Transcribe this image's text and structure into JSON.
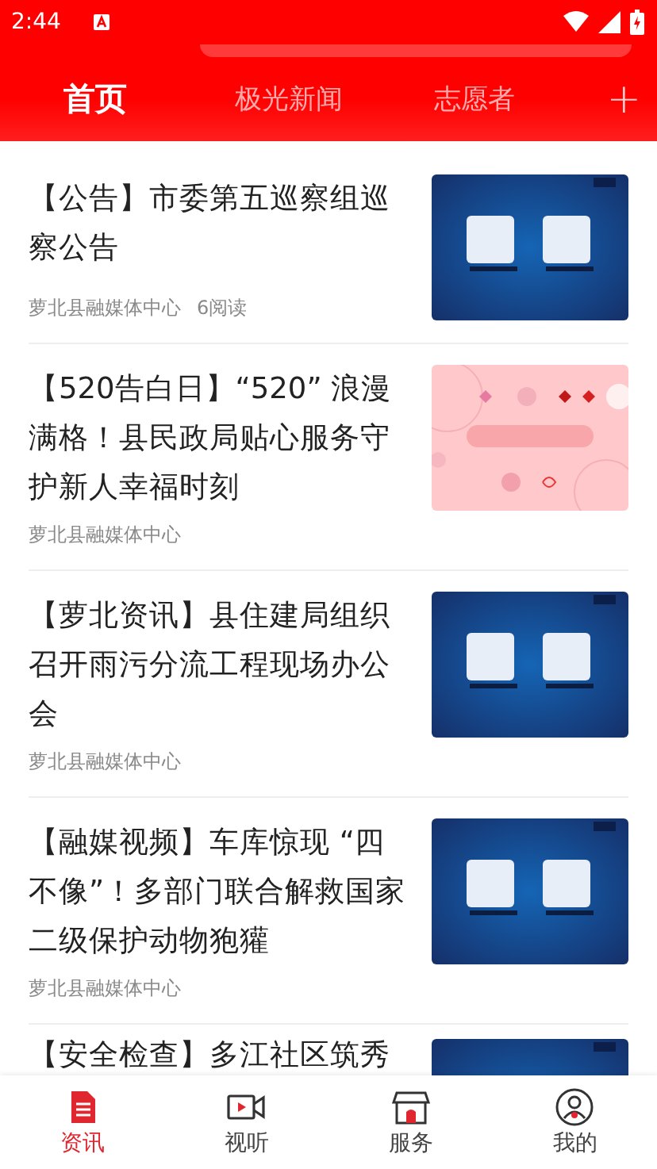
{
  "status_bar": {
    "time": "2:44"
  },
  "tabs": [
    {
      "label": "首页",
      "selected": true
    },
    {
      "label": "极光新闻",
      "selected": false
    },
    {
      "label": "志愿者",
      "selected": false
    }
  ],
  "add_tab": "+",
  "articles": [
    {
      "title": "【公告】市委第五巡察组巡察公告",
      "source": "萝北县融媒体中心",
      "reads": "6阅读"
    },
    {
      "title": "【520告白日】“520” 浪漫满格！县民政局贴心服务守护新人幸福时刻",
      "source": "萝北县融媒体中心"
    },
    {
      "title": "【萝北资讯】县住建局组织召开雨污分流工程现场办公会",
      "source": "萝北县融媒体中心"
    },
    {
      "title": "【融媒视频】车库惊现 “四不像”！多部门联合解救国家二级保护动物狍獾",
      "source": "萝北县融媒体中心"
    },
    {
      "title": "【安全检查】多江社区筑秀"
    }
  ],
  "bottom_nav": [
    {
      "label": "资讯",
      "selected": true
    },
    {
      "label": "视听",
      "selected": false
    },
    {
      "label": "服务",
      "selected": false
    },
    {
      "label": "我的",
      "selected": false
    }
  ]
}
